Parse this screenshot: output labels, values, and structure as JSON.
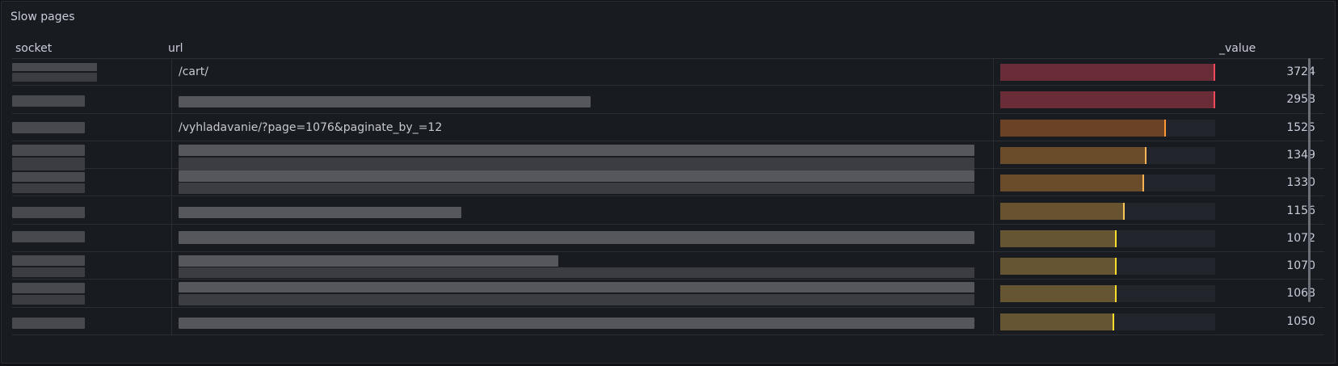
{
  "panel": {
    "title": "Slow pages"
  },
  "columns": {
    "socket": "socket",
    "url": "url",
    "value": "_value"
  },
  "max_value": 3724,
  "rows": [
    {
      "url": "/cart/",
      "value": "3724",
      "fraction": 1.0,
      "fill_color": "#6a2c36",
      "tip_color": "#f2495c"
    },
    {
      "url": "",
      "value": "2958",
      "fraction": 1.0,
      "fill_color": "#6a2c36",
      "tip_color": "#f2495c"
    },
    {
      "url": "/vyhladavanie/?page=1076&paginate_by_=12",
      "value": "1525",
      "fraction": 0.77,
      "fill_color": "#6b4226",
      "tip_color": "#ff9830"
    },
    {
      "url": "",
      "value": "1349",
      "fraction": 0.68,
      "fill_color": "#6a4c2a",
      "tip_color": "#ffb357"
    },
    {
      "url": "",
      "value": "1330",
      "fraction": 0.67,
      "fill_color": "#6a4c2a",
      "tip_color": "#ffb357"
    },
    {
      "url": "",
      "value": "1156",
      "fraction": 0.58,
      "fill_color": "#675330",
      "tip_color": "#fac858"
    },
    {
      "url": "",
      "value": "1072",
      "fraction": 0.54,
      "fill_color": "#665532",
      "tip_color": "#fade2a"
    },
    {
      "url": "",
      "value": "1070",
      "fraction": 0.54,
      "fill_color": "#665532",
      "tip_color": "#fade2a"
    },
    {
      "url": "",
      "value": "1068",
      "fraction": 0.54,
      "fill_color": "#665532",
      "tip_color": "#fade2a"
    },
    {
      "url": "",
      "value": "1050",
      "fraction": 0.53,
      "fill_color": "#665532",
      "tip_color": "#fade2a"
    }
  ]
}
